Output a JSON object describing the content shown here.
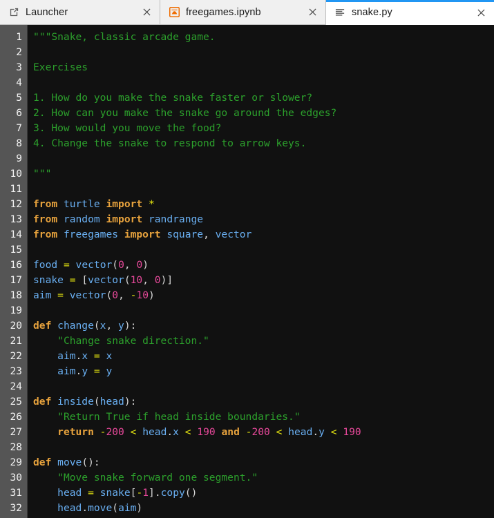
{
  "window": {
    "title": "snake.py",
    "accent_color": "#2196f3",
    "tabbar_bg": "#bdbdbd",
    "editor_bg": "#111111",
    "gutter_bg": "#555555"
  },
  "tabs": [
    {
      "label": "Launcher",
      "icon": "launcher-icon",
      "active": false,
      "close_label": "×"
    },
    {
      "label": "freegames.ipynb",
      "icon": "notebook-icon",
      "active": false,
      "close_label": "×"
    },
    {
      "label": "snake.py",
      "icon": "text-file-icon",
      "active": true,
      "close_label": "×"
    }
  ],
  "editor": {
    "language": "python",
    "filename": "snake.py",
    "first_visible_line": 1,
    "last_visible_line": 32,
    "line_numbers": [
      1,
      2,
      3,
      4,
      5,
      6,
      7,
      8,
      9,
      10,
      11,
      12,
      13,
      14,
      15,
      16,
      17,
      18,
      19,
      20,
      21,
      22,
      23,
      24,
      25,
      26,
      27,
      28,
      29,
      30,
      31,
      32
    ],
    "lines": [
      "\"\"\"Snake, classic arcade game.",
      "",
      "Exercises",
      "",
      "1. How do you make the snake faster or slower?",
      "2. How can you make the snake go around the edges?",
      "3. How would you move the food?",
      "4. Change the snake to respond to arrow keys.",
      "",
      "\"\"\"",
      "",
      "from turtle import *",
      "from random import randrange",
      "from freegames import square, vector",
      "",
      "food = vector(0, 0)",
      "snake = [vector(10, 0)]",
      "aim = vector(0, -10)",
      "",
      "def change(x, y):",
      "    \"Change snake direction.\"",
      "    aim.x = x",
      "    aim.y = y",
      "",
      "def inside(head):",
      "    \"Return True if head inside boundaries.\"",
      "    return -200 < head.x < 190 and -200 < head.y < 190",
      "",
      "def move():",
      "    \"Move snake forward one segment.\"",
      "    head = snake[-1].copy()",
      "    head.move(aim)"
    ],
    "tokens": [
      [
        [
          "\"\"\"Snake, classic arcade game.",
          "str"
        ]
      ],
      [],
      [
        [
          "Exercises",
          "str"
        ]
      ],
      [],
      [
        [
          "1. How do you make the snake faster or slower?",
          "str"
        ]
      ],
      [
        [
          "2. How can you make the snake go around the edges?",
          "str"
        ]
      ],
      [
        [
          "3. How would you move the food?",
          "str"
        ]
      ],
      [
        [
          "4. Change the snake to respond to arrow keys.",
          "str"
        ]
      ],
      [],
      [
        [
          "\"\"\"",
          "str"
        ]
      ],
      [],
      [
        [
          "from",
          "kw"
        ],
        [
          " ",
          "plain"
        ],
        [
          "turtle",
          "name"
        ],
        [
          " ",
          "plain"
        ],
        [
          "import",
          "kw"
        ],
        [
          " ",
          "plain"
        ],
        [
          "*",
          "op"
        ]
      ],
      [
        [
          "from",
          "kw"
        ],
        [
          " ",
          "plain"
        ],
        [
          "random",
          "name"
        ],
        [
          " ",
          "plain"
        ],
        [
          "import",
          "kw"
        ],
        [
          " ",
          "plain"
        ],
        [
          "randrange",
          "name"
        ]
      ],
      [
        [
          "from",
          "kw"
        ],
        [
          " ",
          "plain"
        ],
        [
          "freegames",
          "name"
        ],
        [
          " ",
          "plain"
        ],
        [
          "import",
          "kw"
        ],
        [
          " ",
          "plain"
        ],
        [
          "square",
          "name"
        ],
        [
          ", ",
          "pun"
        ],
        [
          "vector",
          "name"
        ]
      ],
      [],
      [
        [
          "food",
          "name"
        ],
        [
          " ",
          "plain"
        ],
        [
          "=",
          "op"
        ],
        [
          " ",
          "plain"
        ],
        [
          "vector",
          "name"
        ],
        [
          "(",
          "pun"
        ],
        [
          "0",
          "num"
        ],
        [
          ", ",
          "pun"
        ],
        [
          "0",
          "num"
        ],
        [
          ")",
          "pun"
        ]
      ],
      [
        [
          "snake",
          "name"
        ],
        [
          " ",
          "plain"
        ],
        [
          "=",
          "op"
        ],
        [
          " ",
          "plain"
        ],
        [
          "[",
          "pun"
        ],
        [
          "vector",
          "name"
        ],
        [
          "(",
          "pun"
        ],
        [
          "10",
          "num"
        ],
        [
          ", ",
          "pun"
        ],
        [
          "0",
          "num"
        ],
        [
          ")",
          "pun"
        ],
        [
          "]",
          "pun"
        ]
      ],
      [
        [
          "aim",
          "name"
        ],
        [
          " ",
          "plain"
        ],
        [
          "=",
          "op"
        ],
        [
          " ",
          "plain"
        ],
        [
          "vector",
          "name"
        ],
        [
          "(",
          "pun"
        ],
        [
          "0",
          "num"
        ],
        [
          ", ",
          "pun"
        ],
        [
          "-",
          "op"
        ],
        [
          "10",
          "num"
        ],
        [
          ")",
          "pun"
        ]
      ],
      [],
      [
        [
          "def",
          "kw"
        ],
        [
          " ",
          "plain"
        ],
        [
          "change",
          "name"
        ],
        [
          "(",
          "pun"
        ],
        [
          "x",
          "name"
        ],
        [
          ", ",
          "pun"
        ],
        [
          "y",
          "name"
        ],
        [
          "):",
          "pun"
        ]
      ],
      [
        [
          "    ",
          "plain"
        ],
        [
          "\"Change snake direction.\"",
          "str"
        ]
      ],
      [
        [
          "    ",
          "plain"
        ],
        [
          "aim",
          "name"
        ],
        [
          ".",
          "pun"
        ],
        [
          "x",
          "name"
        ],
        [
          " ",
          "plain"
        ],
        [
          "=",
          "op"
        ],
        [
          " ",
          "plain"
        ],
        [
          "x",
          "name"
        ]
      ],
      [
        [
          "    ",
          "plain"
        ],
        [
          "aim",
          "name"
        ],
        [
          ".",
          "pun"
        ],
        [
          "y",
          "name"
        ],
        [
          " ",
          "plain"
        ],
        [
          "=",
          "op"
        ],
        [
          " ",
          "plain"
        ],
        [
          "y",
          "name"
        ]
      ],
      [],
      [
        [
          "def",
          "kw"
        ],
        [
          " ",
          "plain"
        ],
        [
          "inside",
          "name"
        ],
        [
          "(",
          "pun"
        ],
        [
          "head",
          "name"
        ],
        [
          "):",
          "pun"
        ]
      ],
      [
        [
          "    ",
          "plain"
        ],
        [
          "\"Return True if head inside boundaries.\"",
          "str"
        ]
      ],
      [
        [
          "    ",
          "plain"
        ],
        [
          "return",
          "kw"
        ],
        [
          " ",
          "plain"
        ],
        [
          "-",
          "op"
        ],
        [
          "200",
          "num"
        ],
        [
          " ",
          "plain"
        ],
        [
          "<",
          "op"
        ],
        [
          " ",
          "plain"
        ],
        [
          "head",
          "name"
        ],
        [
          ".",
          "pun"
        ],
        [
          "x",
          "name"
        ],
        [
          " ",
          "plain"
        ],
        [
          "<",
          "op"
        ],
        [
          " ",
          "plain"
        ],
        [
          "190",
          "num"
        ],
        [
          " ",
          "plain"
        ],
        [
          "and",
          "kw"
        ],
        [
          " ",
          "plain"
        ],
        [
          "-",
          "op"
        ],
        [
          "200",
          "num"
        ],
        [
          " ",
          "plain"
        ],
        [
          "<",
          "op"
        ],
        [
          " ",
          "plain"
        ],
        [
          "head",
          "name"
        ],
        [
          ".",
          "pun"
        ],
        [
          "y",
          "name"
        ],
        [
          " ",
          "plain"
        ],
        [
          "<",
          "op"
        ],
        [
          " ",
          "plain"
        ],
        [
          "190",
          "num"
        ]
      ],
      [],
      [
        [
          "def",
          "kw"
        ],
        [
          " ",
          "plain"
        ],
        [
          "move",
          "name"
        ],
        [
          "():",
          "pun"
        ]
      ],
      [
        [
          "    ",
          "plain"
        ],
        [
          "\"Move snake forward one segment.\"",
          "str"
        ]
      ],
      [
        [
          "    ",
          "plain"
        ],
        [
          "head",
          "name"
        ],
        [
          " ",
          "plain"
        ],
        [
          "=",
          "op"
        ],
        [
          " ",
          "plain"
        ],
        [
          "snake",
          "name"
        ],
        [
          "[",
          "pun"
        ],
        [
          "-",
          "op"
        ],
        [
          "1",
          "num"
        ],
        [
          "]",
          "pun"
        ],
        [
          ".",
          "pun"
        ],
        [
          "copy",
          "name"
        ],
        [
          "()",
          "pun"
        ]
      ],
      [
        [
          "    ",
          "plain"
        ],
        [
          "head",
          "name"
        ],
        [
          ".",
          "pun"
        ],
        [
          "move",
          "name"
        ],
        [
          "(",
          "pun"
        ],
        [
          "aim",
          "name"
        ],
        [
          ")",
          "pun"
        ]
      ]
    ],
    "syntax_colors": {
      "string": "#2ca02c",
      "keyword": "#e8a33d",
      "name": "#6ab0f3",
      "operator": "#e5e510",
      "number": "#e8499b",
      "punctuation": "#d8d8d8",
      "line_number": "#f2f2f2"
    }
  }
}
